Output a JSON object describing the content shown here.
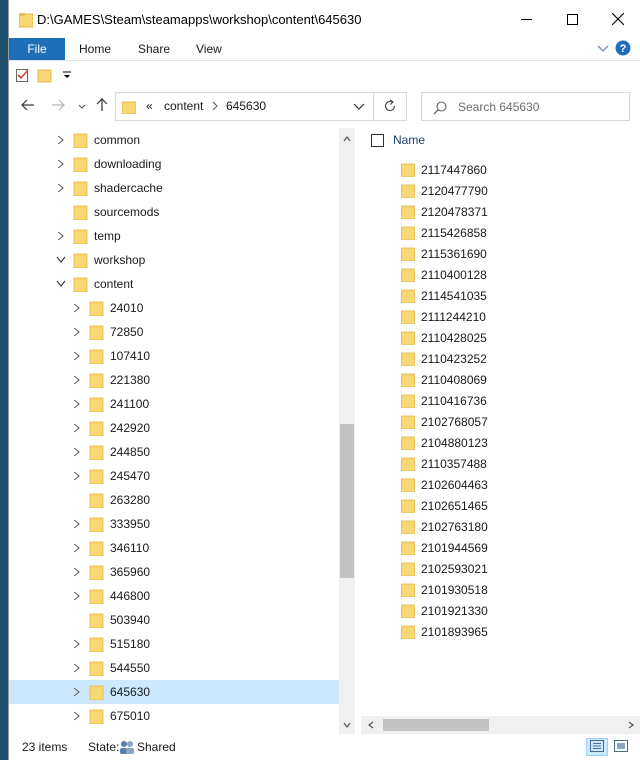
{
  "window": {
    "title": "D:\\GAMES\\Steam\\steamapps\\workshop\\content\\645630"
  },
  "ribbon": {
    "tabs": [
      "File",
      "Home",
      "Share",
      "View"
    ]
  },
  "address": {
    "overflow": "«",
    "parts": [
      "content",
      "645630"
    ]
  },
  "search": {
    "placeholder": "Search 645630"
  },
  "tree": [
    {
      "label": "common",
      "expander": "collapsed"
    },
    {
      "label": "downloading",
      "expander": "collapsed"
    },
    {
      "label": "shadercache",
      "expander": "collapsed"
    },
    {
      "label": "sourcemods",
      "expander": "none"
    },
    {
      "label": "temp",
      "expander": "collapsed"
    },
    {
      "label": "workshop",
      "expander": "expanded"
    },
    {
      "label": "content",
      "expander": "expanded"
    },
    {
      "label": "24010",
      "expander": "collapsed"
    },
    {
      "label": "72850",
      "expander": "collapsed"
    },
    {
      "label": "107410",
      "expander": "collapsed"
    },
    {
      "label": "221380",
      "expander": "collapsed"
    },
    {
      "label": "241100",
      "expander": "collapsed"
    },
    {
      "label": "242920",
      "expander": "collapsed"
    },
    {
      "label": "244850",
      "expander": "collapsed"
    },
    {
      "label": "245470",
      "expander": "collapsed"
    },
    {
      "label": "263280",
      "expander": "none"
    },
    {
      "label": "333950",
      "expander": "collapsed"
    },
    {
      "label": "346110",
      "expander": "collapsed"
    },
    {
      "label": "365960",
      "expander": "collapsed"
    },
    {
      "label": "446800",
      "expander": "collapsed"
    },
    {
      "label": "503940",
      "expander": "none"
    },
    {
      "label": "515180",
      "expander": "collapsed"
    },
    {
      "label": "544550",
      "expander": "collapsed"
    },
    {
      "label": "645630",
      "expander": "collapsed",
      "selected": true
    },
    {
      "label": "675010",
      "expander": "collapsed"
    }
  ],
  "content": {
    "column_header": "Name",
    "items": [
      "2117447860",
      "2120477790",
      "2120478371",
      "2115426858",
      "2115361690",
      "2110400128",
      "2114541035",
      "2111244210",
      "2110428025",
      "2110423252",
      "2110408069",
      "2110416736",
      "2102768057",
      "2104880123",
      "2110357488",
      "2102604463",
      "2102651465",
      "2102763180",
      "2101944569",
      "2102593021",
      "2101930518",
      "2101921330",
      "2101893965"
    ]
  },
  "status": {
    "item_count": "23 items",
    "state_label": "State:",
    "state_value": "Shared"
  },
  "colors": {
    "accent": "#1f6fb8",
    "selection": "#cce8ff",
    "folder": "#f8d775",
    "folder_dark": "#e0b847"
  },
  "icons": {
    "title": "folder-icon",
    "minimize": "minimize-icon",
    "maximize": "maximize-icon",
    "close": "close-icon",
    "expand_ribbon": "chevron-down-icon",
    "help": "help-icon",
    "back": "back-arrow-icon",
    "forward": "forward-arrow-icon",
    "up": "up-arrow-icon",
    "refresh": "refresh-icon",
    "search": "search-icon"
  }
}
